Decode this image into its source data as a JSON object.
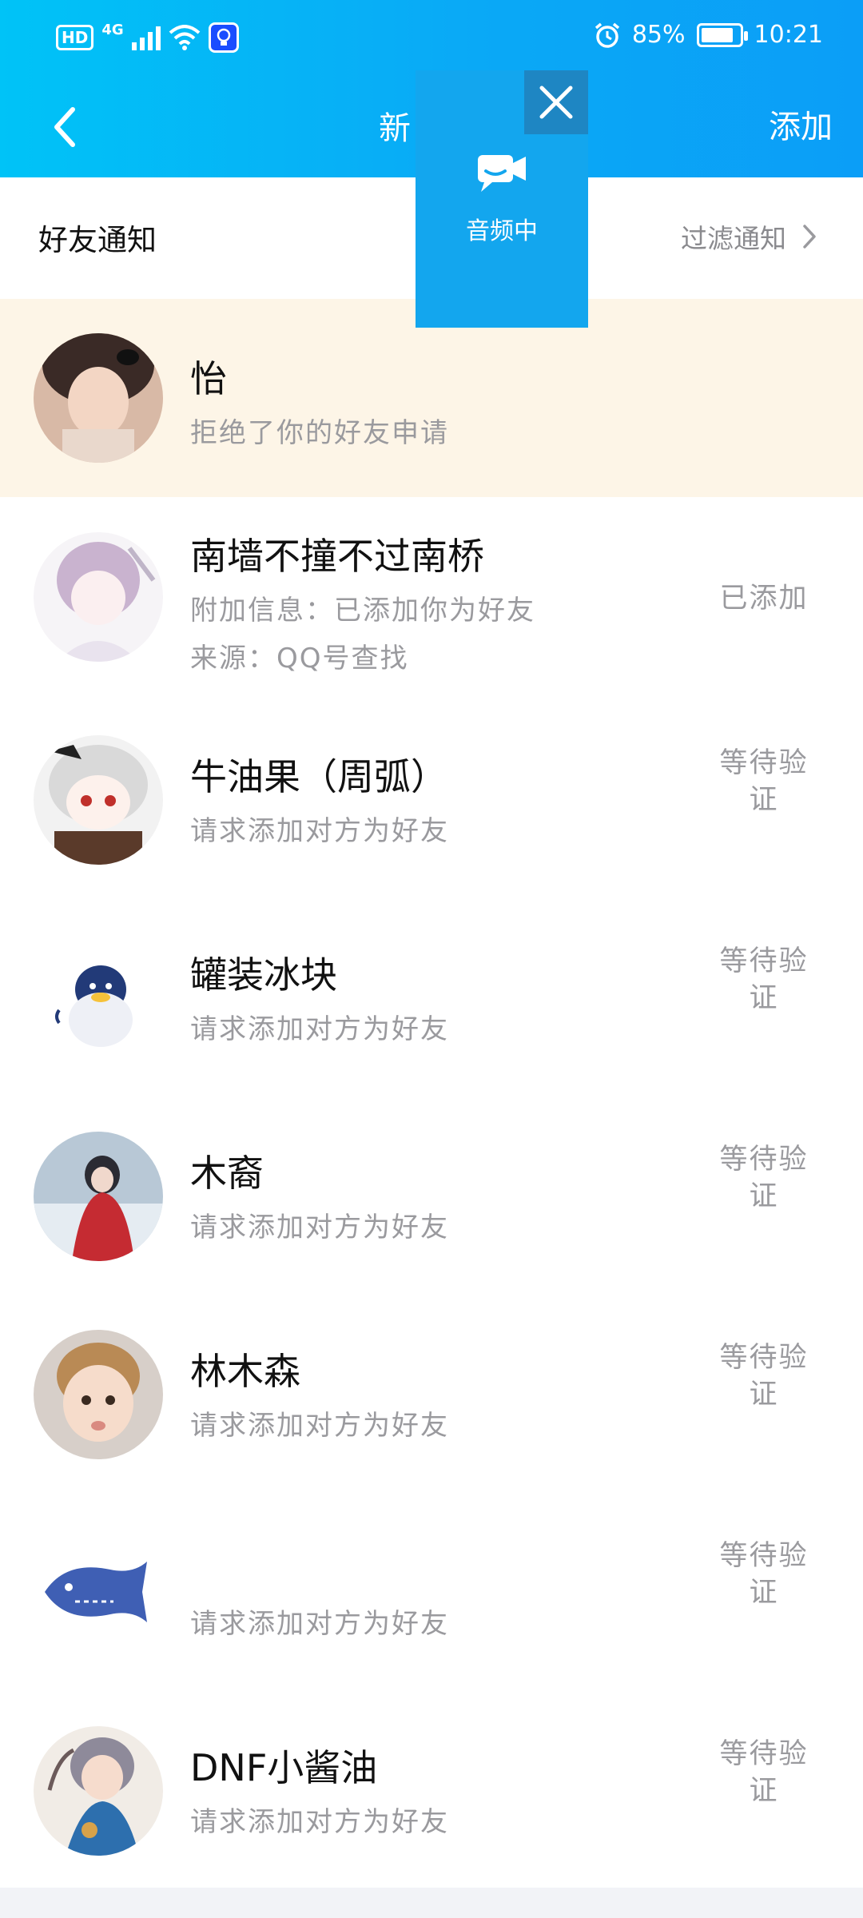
{
  "status_bar": {
    "hd": "HD",
    "network": "4G",
    "battery_percent": "85%",
    "battery_level": 0.85,
    "time": "10:21"
  },
  "nav": {
    "title": "新",
    "add_label": "添加"
  },
  "video_popup": {
    "label": "音频中"
  },
  "notice": {
    "title": "好友通知",
    "filter_label": "过滤通知"
  },
  "items": [
    {
      "name": "怡",
      "sub1": "拒绝了你的好友申请",
      "sub2": "",
      "status": ""
    },
    {
      "name": "南墙不撞不过南桥",
      "sub1": "附加信息：已添加你为好友",
      "sub2": "来源：QQ号查找",
      "status": "已添加"
    },
    {
      "name": "牛油果（周弧）",
      "sub1": "请求添加对方为好友",
      "sub2": "",
      "status": "等待验证"
    },
    {
      "name": "罐装冰块",
      "sub1": "请求添加对方为好友",
      "sub2": "",
      "status": "等待验证"
    },
    {
      "name": "木裔",
      "sub1": "请求添加对方为好友",
      "sub2": "",
      "status": "等待验证"
    },
    {
      "name": "林木森",
      "sub1": "请求添加对方为好友",
      "sub2": "",
      "status": "等待验证"
    },
    {
      "name": "",
      "sub1": "请求添加对方为好友",
      "sub2": "",
      "status": "等待验证"
    },
    {
      "name": "DNF小酱油",
      "sub1": "请求添加对方为好友",
      "sub2": "",
      "status": "等待验证"
    }
  ],
  "colors": {
    "header_start": "#00c3f7",
    "header_end": "#0b9ef7",
    "highlight_row": "#fdf5e7",
    "popup": "#13a6ee"
  }
}
